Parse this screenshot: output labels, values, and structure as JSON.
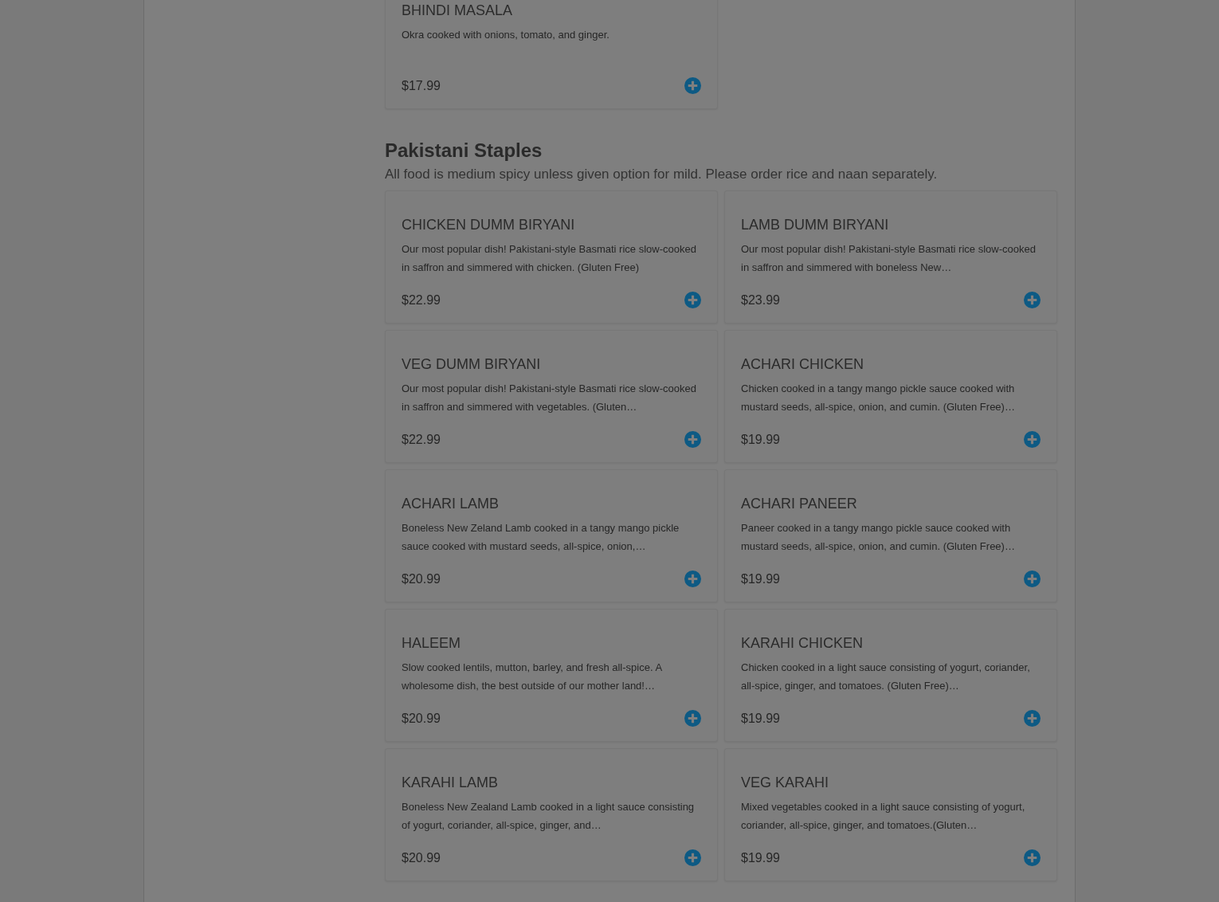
{
  "sections": [
    {
      "items": [
        {
          "name": "BHINDI MASALA",
          "description": "Okra cooked with onions, tomato, and ginger.",
          "price": "$17.99"
        }
      ]
    },
    {
      "title": "Pakistani Staples",
      "note": "All food is medium spicy unless given option for mild. Please order rice and naan separately.",
      "items": [
        {
          "name": "CHICKEN DUMM BIRYANI",
          "description": "Our most popular dish! Pakistani-style Basmati rice slow-cooked in saffron and simmered with chicken. (Gluten Free)",
          "price": "$22.99"
        },
        {
          "name": "LAMB DUMM BIRYANI",
          "description": "Our most popular dish! Pakistani-style Basmati rice slow-cooked in saffron and simmered with boneless New…",
          "price": "$23.99"
        },
        {
          "name": "VEG DUMM BIRYANI",
          "description": "Our most popular dish! Pakistani-style Basmati rice slow-cooked in saffron and simmered with vegetables. (Gluten…",
          "price": "$22.99"
        },
        {
          "name": "ACHARI CHICKEN",
          "description": "Chicken cooked in a tangy mango pickle sauce cooked with mustard seeds, all-spice, onion, and cumin. (Gluten Free)…",
          "price": "$19.99"
        },
        {
          "name": "ACHARI LAMB",
          "description": "Boneless New Zeland Lamb cooked in a tangy mango pickle sauce cooked with mustard seeds, all-spice, onion,…",
          "price": "$20.99"
        },
        {
          "name": "ACHARI PANEER",
          "description": "Paneer cooked in a tangy mango pickle sauce cooked with mustard seeds, all-spice, onion, and cumin. (Gluten Free)…",
          "price": "$19.99"
        },
        {
          "name": "HALEEM",
          "description": "Slow cooked lentils, mutton, barley, and fresh all-spice. A wholesome dish, the best outside of our mother land!…",
          "price": "$20.99"
        },
        {
          "name": "KARAHI CHICKEN",
          "description": "Chicken cooked in a light sauce consisting of yogurt, coriander, all-spice, ginger, and tomatoes. (Gluten Free)…",
          "price": "$19.99"
        },
        {
          "name": "KARAHI LAMB",
          "description": "Boneless New Zealand Lamb cooked in a light sauce consisting of yogurt, coriander, all-spice, ginger, and…",
          "price": "$20.99"
        },
        {
          "name": "VEG KARAHI",
          "description": "Mixed vegetables cooked in a light sauce consisting of yogurt, coriander, all-spice, ginger, and tomatoes.(Gluten…",
          "price": "$19.99"
        }
      ]
    }
  ]
}
